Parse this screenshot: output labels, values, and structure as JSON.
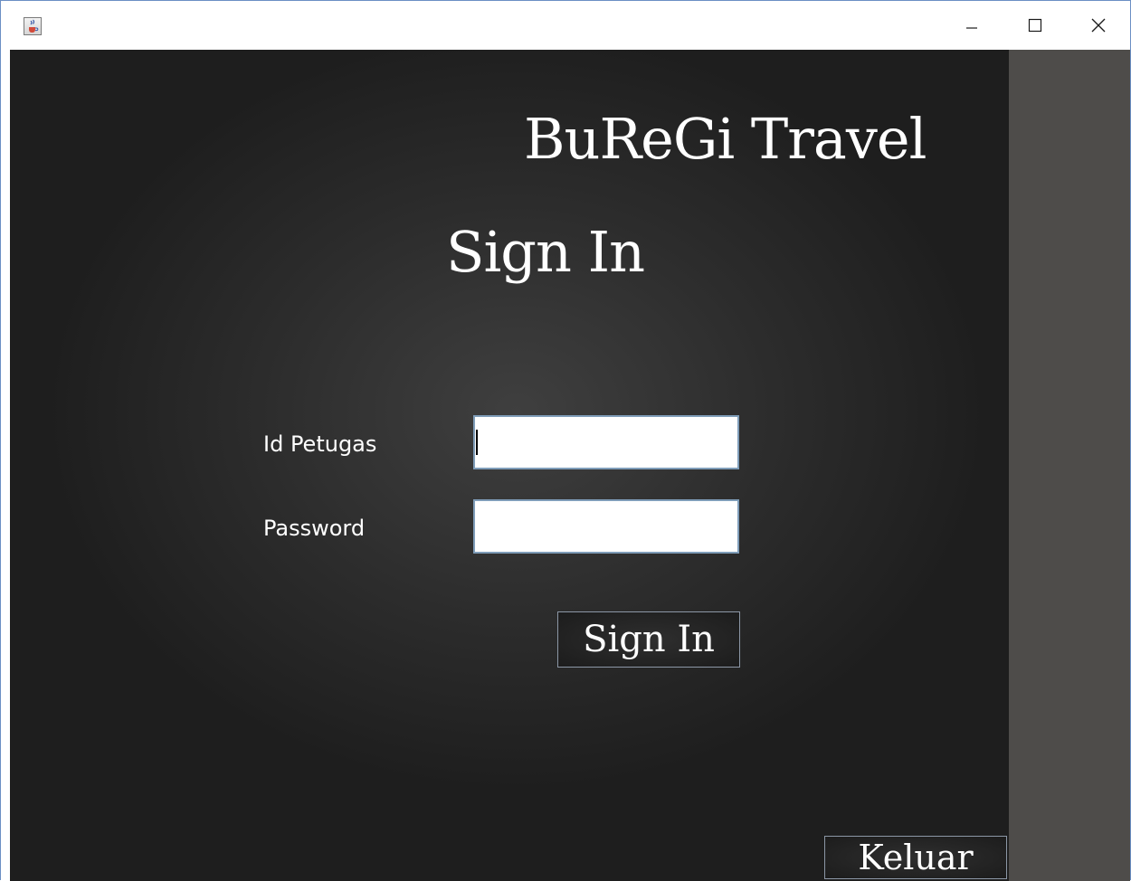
{
  "window": {
    "title": "",
    "app_icon": "java-cup-icon",
    "controls": {
      "minimize": "minimize-icon",
      "maximize": "maximize-icon",
      "close": "close-icon"
    }
  },
  "brand": {
    "name": "BuReGi Travel"
  },
  "form": {
    "heading": "Sign In",
    "id_label": "Id Petugas",
    "id_value": "",
    "password_label": "Password",
    "password_value": "",
    "submit_label": "Sign In"
  },
  "footer": {
    "exit_label": "Keluar"
  },
  "colors": {
    "background_dark": "#2c2c2c",
    "side_panel": "#4e4c4a",
    "field_border": "#7f9db9",
    "button_border": "#8c97a6",
    "text": "#ffffff"
  }
}
